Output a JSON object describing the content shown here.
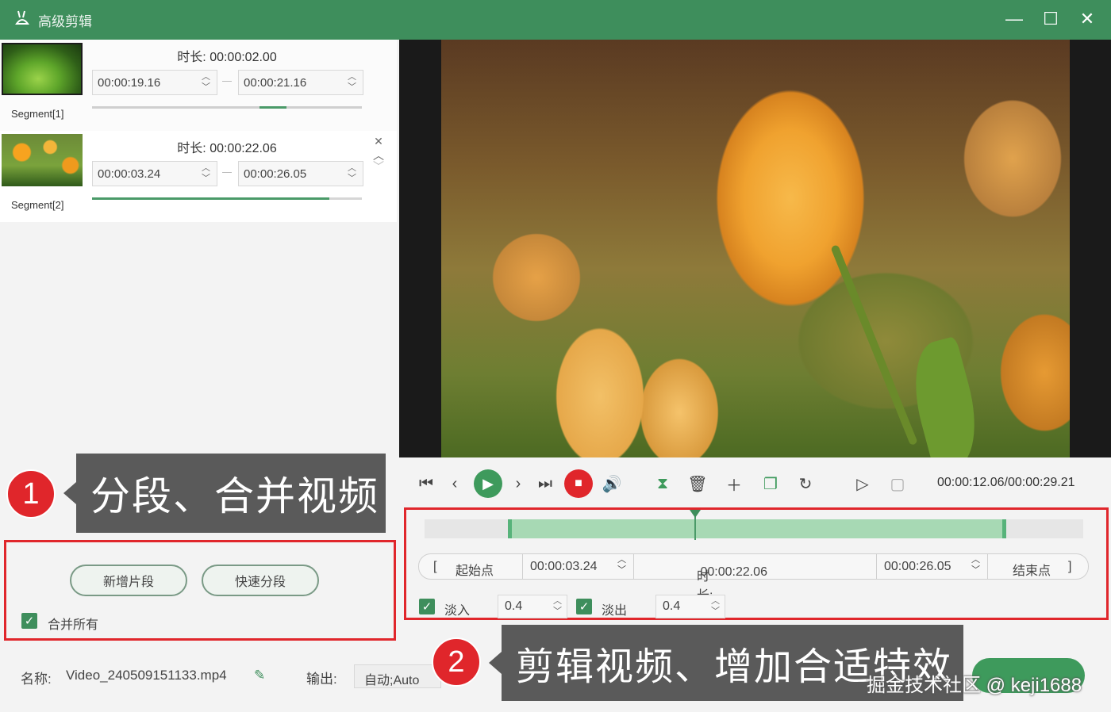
{
  "window": {
    "title": "高级剪辑",
    "logo_icon": "rabbit-logo",
    "minimize": "—",
    "maximize": "☐",
    "close": "✕"
  },
  "segments": [
    {
      "label": "Segment[1]",
      "duration_label": "时长:",
      "duration": "00:00:02.00",
      "start": "00:00:19.16",
      "end": "00:00:21.16"
    },
    {
      "label": "Segment[2]",
      "duration_label": "时长:",
      "duration": "00:00:22.06",
      "start": "00:00:03.24",
      "end": "00:00:26.05"
    }
  ],
  "callouts": {
    "one_number": "1",
    "one_text": "分段、合并视频",
    "two_number": "2",
    "two_text": "剪辑视频、增加合适特效"
  },
  "segment_actions": {
    "add_segment": "新增片段",
    "quick_split": "快速分段",
    "merge_all": "合并所有",
    "merge_all_checked": true
  },
  "player": {
    "timecode": "00:00:12.06/00:00:29.21",
    "playhead_fraction": 0.41
  },
  "trim": {
    "start_label": "起始点",
    "start_value": "00:00:03.24",
    "duration_label": "时长:",
    "duration_value": "00:00:22.06",
    "end_value": "00:00:26.05",
    "end_label": "结束点",
    "fade_in_label": "淡入",
    "fade_in_value": "0.4",
    "fade_out_label": "淡出",
    "fade_out_value": "0.4"
  },
  "bottom": {
    "name_label": "名称:",
    "file_name": "Video_240509151133.mp4",
    "output_label": "输出:",
    "output_value": "自动;Auto"
  },
  "watermark": "掘金技术社区 @ keji1688",
  "colors": {
    "accent": "#3e8e5c",
    "highlight": "#e0262b"
  }
}
